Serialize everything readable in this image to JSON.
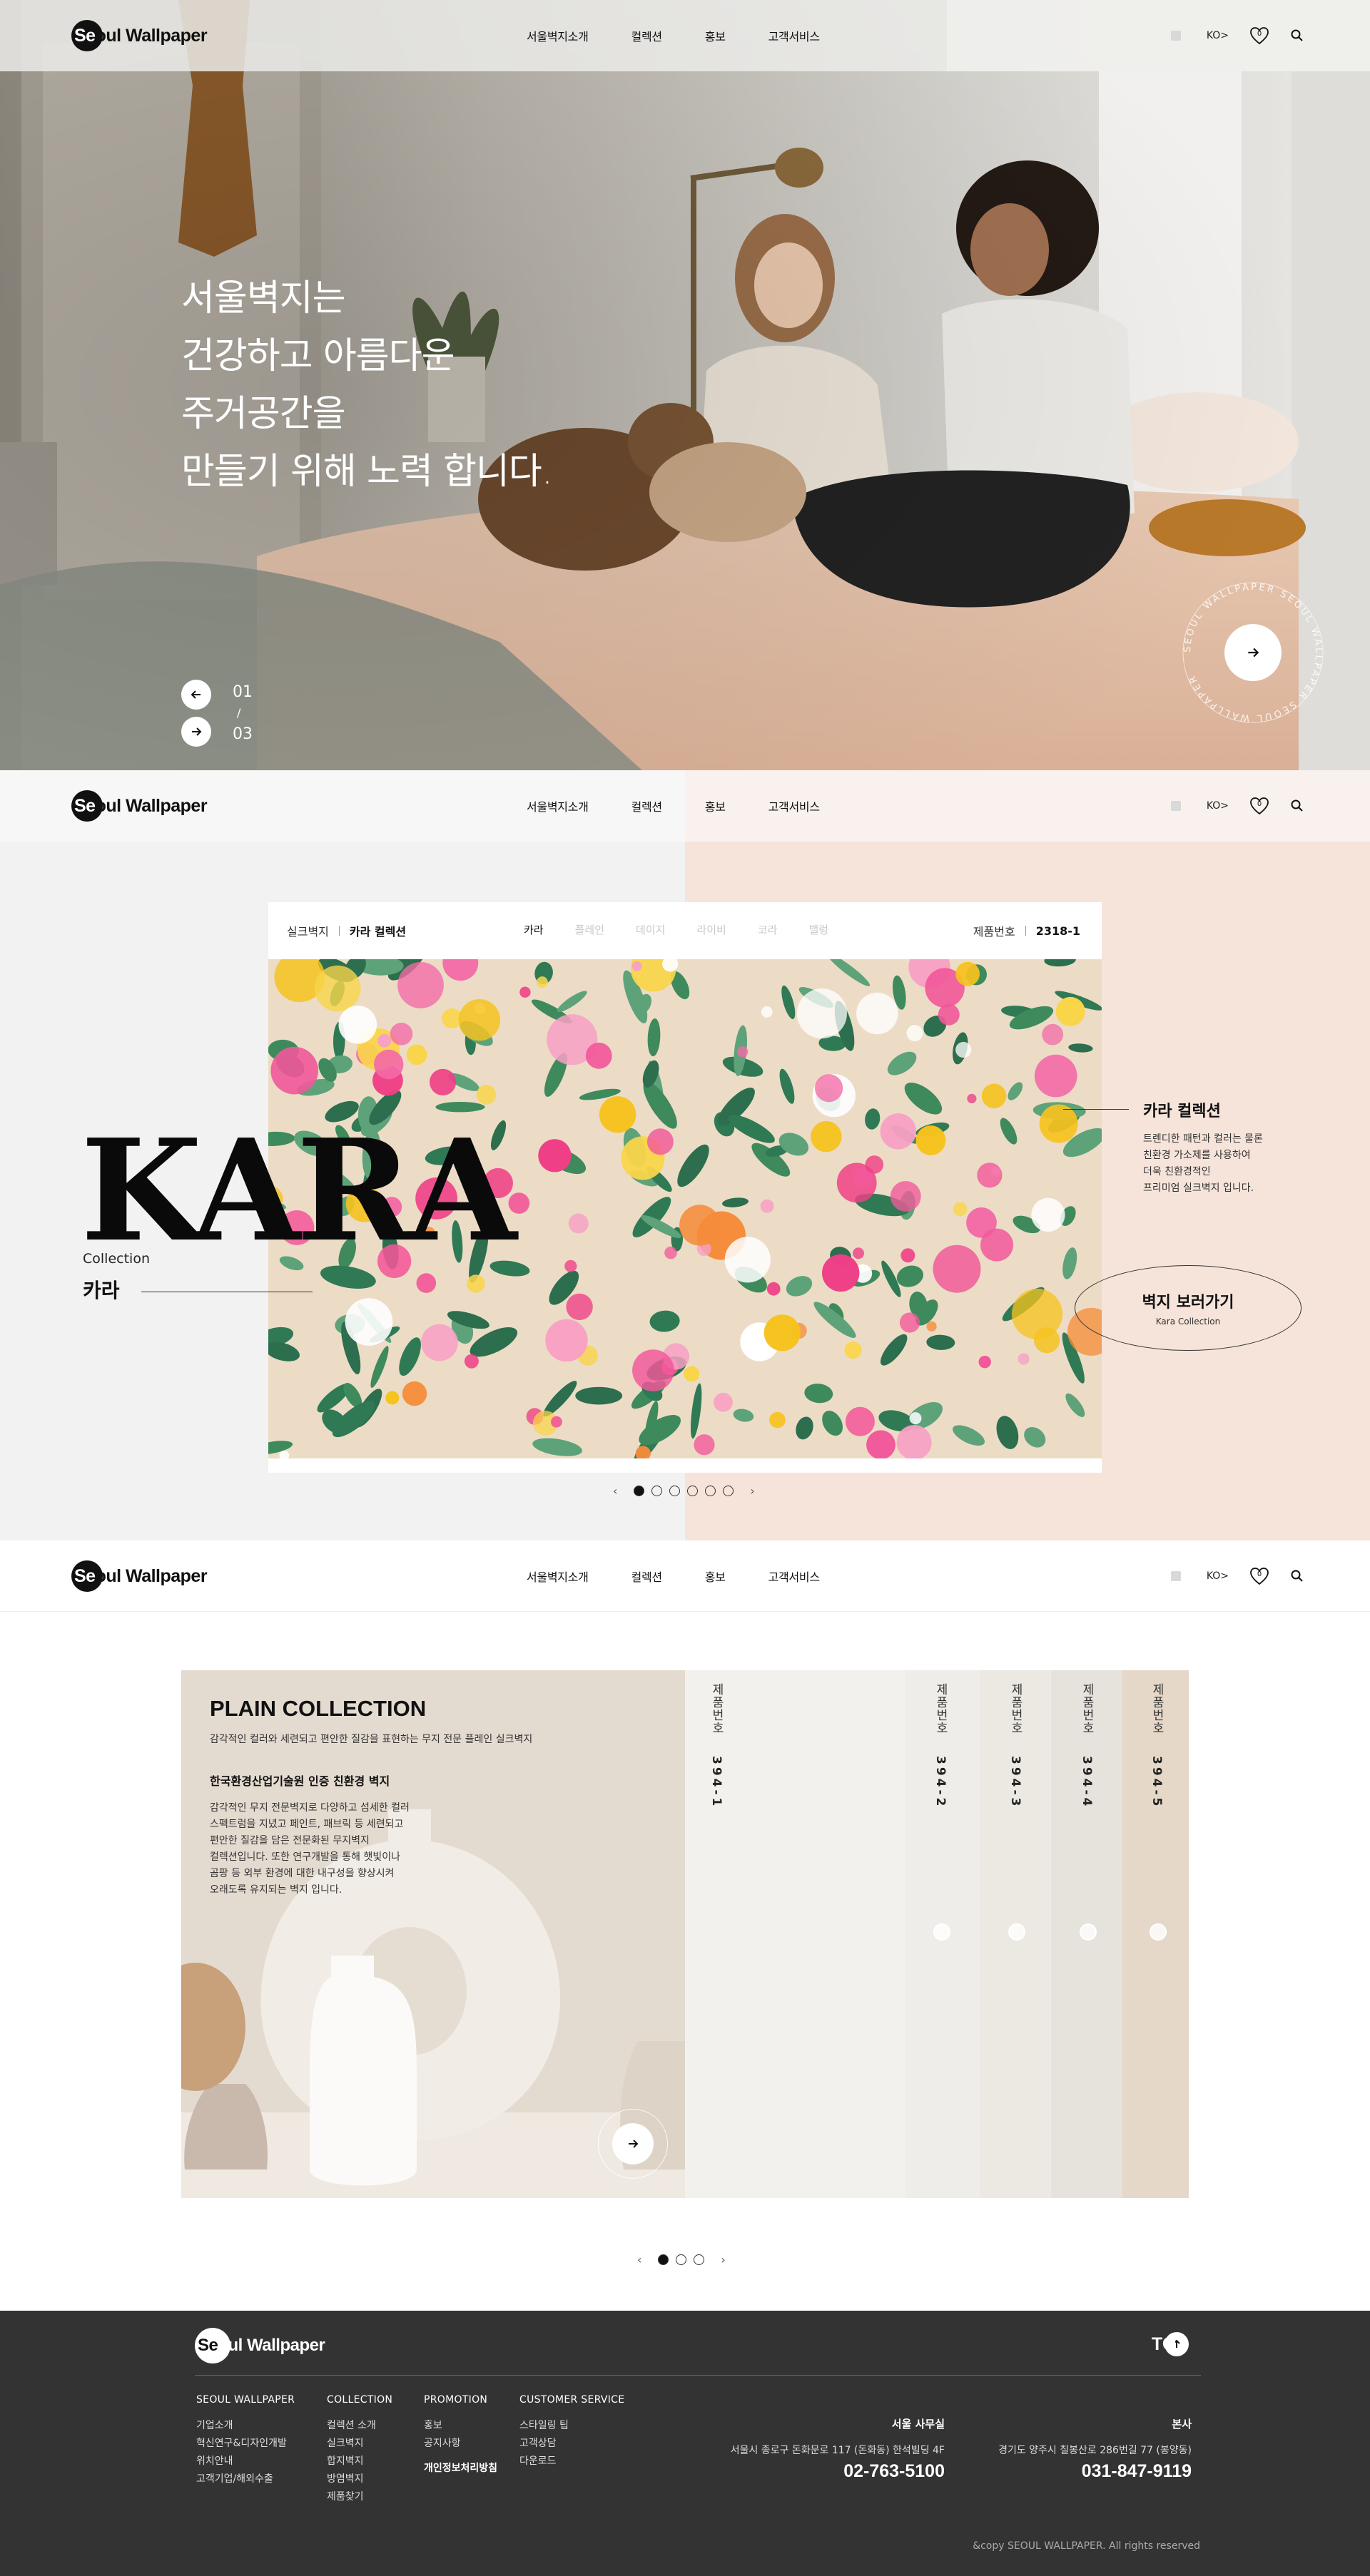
{
  "header": {
    "logo_text_inner": "Se",
    "logo_text_outer": "oul Wallpaper",
    "nav": [
      "서울벽지소개",
      "컬렉션",
      "홍보",
      "고객서비스"
    ],
    "lang": "KO>",
    "wishlist_count": "0",
    "icons": [
      "language-square-icon",
      "heart-icon",
      "search-icon"
    ]
  },
  "hero": {
    "lines": [
      "서울벽지는",
      "건강하고 아름다운",
      "주거공간을",
      "만들기 위해 노력 합니다."
    ],
    "current": "01",
    "slash": "/",
    "total": "03",
    "ring_text": "SEOUL WALLPAPER SEOUL WALLPAPER SEOUL WALLPAPER"
  },
  "kara": {
    "breadcrumb": [
      "실크벽지",
      "카라 컬렉션"
    ],
    "tabs": [
      "카라",
      "플레인",
      "데이지",
      "라이비",
      "코라",
      "밸렁"
    ],
    "active_tab": 0,
    "product_no_label": "제품번호",
    "product_no": "2318-1",
    "title": "KARA",
    "collection_label": "Collection",
    "name_ko": "카라",
    "info_title": "카라 컬렉션",
    "info_lines": [
      "트렌디한 패턴과 컬러는 물론",
      "친환경 가소제를 사용하여",
      "더욱 친환경적인",
      "프리미엄 실크벽지 입니다."
    ],
    "cta_title": "벽지 보러가기",
    "cta_sub": "Kara Collection",
    "pager_count": 6,
    "pager_active": 0
  },
  "plain": {
    "title": "PLAIN COLLECTION",
    "subtitle": "감각적인 컬러와 세련되고 편안한 질감을 표현하는 무지 전문 플레인 실크벽지",
    "cert_title": "한국환경산업기술원 인증 친환경 벽지",
    "desc_lines": [
      "감각적인 무지 전문벽지로 다양하고 섬세한 컬러",
      "스펙트럼을 지녔고 페인트, 패브릭 등 세련되고",
      "편안한 질감을 담은 전문화된 무지벽지",
      "컬렉션입니다. 또한 연구개발을 통해 햇빛이나",
      "곰팡 등 외부 환경에 대한 내구성을 향상시켜",
      "오래도록 유지되는 벽지 입니다."
    ],
    "strips": [
      {
        "label": "제품번호",
        "number": "394-1"
      },
      {
        "label": "제품번호",
        "number": "394-2"
      },
      {
        "label": "제품번호",
        "number": "394-3"
      },
      {
        "label": "제품번호",
        "number": "394-4"
      },
      {
        "label": "제품번호",
        "number": "394-5"
      }
    ],
    "pager_count": 3,
    "pager_active": 0
  },
  "footer": {
    "logo_inner": "Se",
    "logo_outer": "oul Wallpaper",
    "top_label": "TO",
    "columns": [
      {
        "title": "SEOUL WALLPAPER",
        "items": [
          "기업소개",
          "혁신연구&디자인개발",
          "위치안내",
          "고객기업/해외수출"
        ]
      },
      {
        "title": "COLLECTION",
        "items": [
          "컬렉션 소개",
          "실크벽지",
          "합지벽지",
          "방염벽지",
          "제품찾기"
        ]
      },
      {
        "title": "PROMOTION",
        "items": [
          "홍보",
          "공지사항"
        ],
        "bold": "개인정보처리방침"
      },
      {
        "title": "CUSTOMER SERVICE",
        "items": [
          "스타일링 팁",
          "고객상담",
          "다운로드"
        ]
      }
    ],
    "offices": [
      {
        "title": "서울 사무실",
        "address": "서울시 종로구 돈화문로 117 (돈화동) 한석빌딩 4F",
        "phone": "02-763-5100"
      },
      {
        "title": "본사",
        "address": "경기도 양주시 칠봉산로 286번길 77 (봉양동)",
        "phone": "031-847-9119"
      }
    ],
    "copyright": "&copy SEOUL WALLPAPER. All rights reserved"
  },
  "colors": {
    "footer_bg": "#333333",
    "kara_right_bg": "#f6e4da",
    "kara_left_bg": "#f2f2f2",
    "plain_left_bg": "#e6ddd3"
  }
}
